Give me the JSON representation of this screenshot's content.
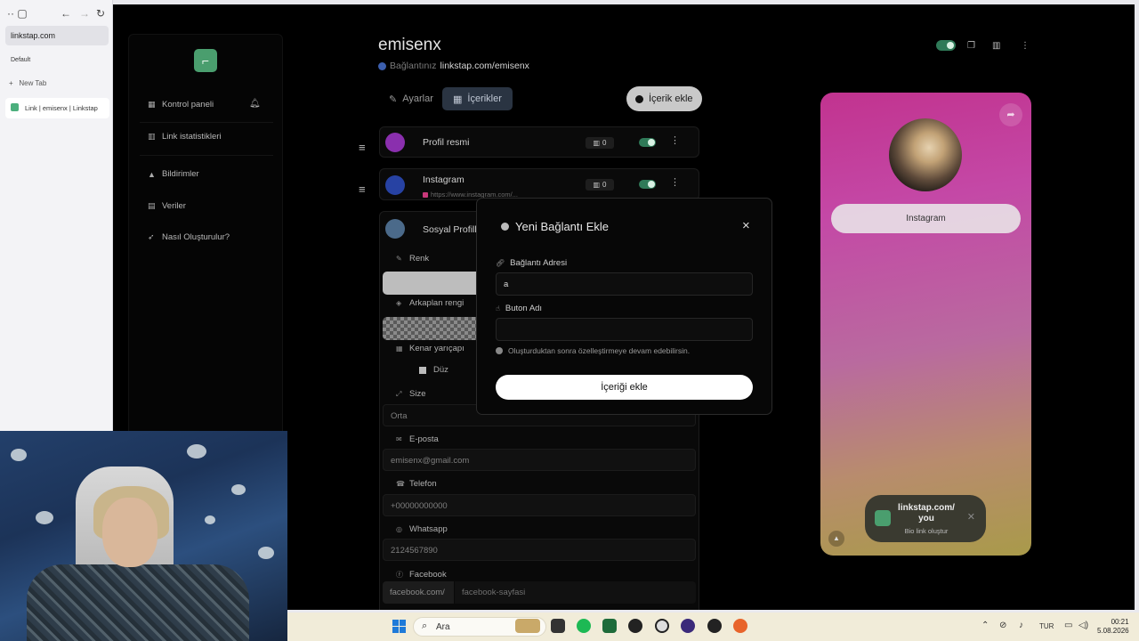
{
  "browser": {
    "url": "linkstap.com",
    "profile": "Default",
    "new_tab": "New Tab",
    "active_tab": "Link | emisenx | Linkstap"
  },
  "sidebar": {
    "items": [
      {
        "label": "Kontrol paneli",
        "icon": "grid-icon"
      },
      {
        "label": "Link istatistikleri",
        "icon": "chart-icon"
      },
      {
        "label": "Bildirimler",
        "icon": "bell-icon"
      },
      {
        "label": "Veriler",
        "icon": "database-icon"
      },
      {
        "label": "Nasıl Oluşturulur?",
        "icon": "rocket-icon"
      }
    ]
  },
  "header": {
    "username": "emisenx",
    "connection_label": "Bağlantınız",
    "connection_url": "linkstap.com/emisenx"
  },
  "tabs": {
    "settings": "Ayarlar",
    "contents": "İçerikler",
    "add_content": "İçerik ekle"
  },
  "cards": [
    {
      "title": "Profil resmi",
      "count": "0",
      "avatar_color": "#8a2fae"
    },
    {
      "title": "Instagram",
      "url": "https://www.instagram.com/...",
      "count": "0",
      "avatar_color": "#2742a3"
    },
    {
      "title": "Sosyal Profill",
      "avatar_color": "#4b6a8a"
    }
  ],
  "social_form": {
    "color_label": "Renk",
    "bg_color_label": "Arkaplan rengi",
    "radius_label": "Kenar yarıçapı",
    "radius_value": "Düz",
    "size_label": "Size",
    "size_value": "Orta",
    "email_label": "E-posta",
    "email_value": "emisenx@gmail.com",
    "phone_label": "Telefon",
    "phone_placeholder": "+00000000000",
    "whatsapp_label": "Whatsapp",
    "whatsapp_placeholder": "2124567890",
    "facebook_label": "Facebook",
    "facebook_prefix": "facebook.com/",
    "facebook_placeholder": "facebook-sayfasi"
  },
  "modal": {
    "title": "Yeni Bağlantı Ekle",
    "close": "×",
    "url_label": "Bağlantı Adresi",
    "url_value": "a",
    "button_label": "Buton Adı",
    "button_value": "",
    "hint": "Oluşturduktan sonra özelleştirmeye devam edebilirsin.",
    "submit": "İçeriği ekle"
  },
  "preview": {
    "button": "Instagram",
    "promo_title": "linkstap.com/ you",
    "promo_subtitle": "Bio link oluştur"
  },
  "taskbar": {
    "search": "Ara",
    "language": "TUR",
    "time": "00:21",
    "date": "5.08.2026"
  },
  "colors": {
    "accent_green": "#2f7a58",
    "logo_green": "#4a9e6e",
    "tab_active_bg": "#2a3442"
  }
}
